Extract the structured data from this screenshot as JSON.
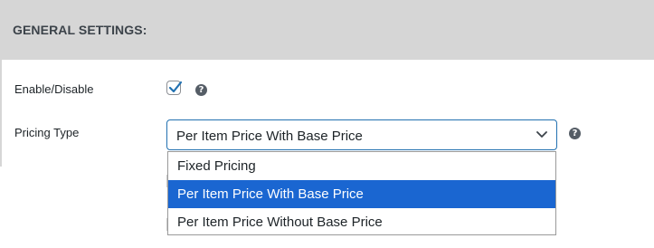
{
  "section": {
    "title": "GENERAL SETTINGS:"
  },
  "rows": {
    "enable": {
      "label": "Enable/Disable",
      "checked": true
    },
    "pricing": {
      "label": "Pricing Type"
    }
  },
  "help_icon": {
    "glyph": "?"
  },
  "pricing_select": {
    "value": "Per Item Price With Base Price",
    "options": [
      {
        "label": "Fixed Pricing",
        "selected": false
      },
      {
        "label": "Per Item Price With Base Price",
        "selected": true
      },
      {
        "label": "Per Item Price Without Base Price",
        "selected": false
      }
    ]
  },
  "colors": {
    "header_bg": "#d6d6d6",
    "accent": "#2271b1",
    "selected_option_bg": "#1a66d1"
  }
}
